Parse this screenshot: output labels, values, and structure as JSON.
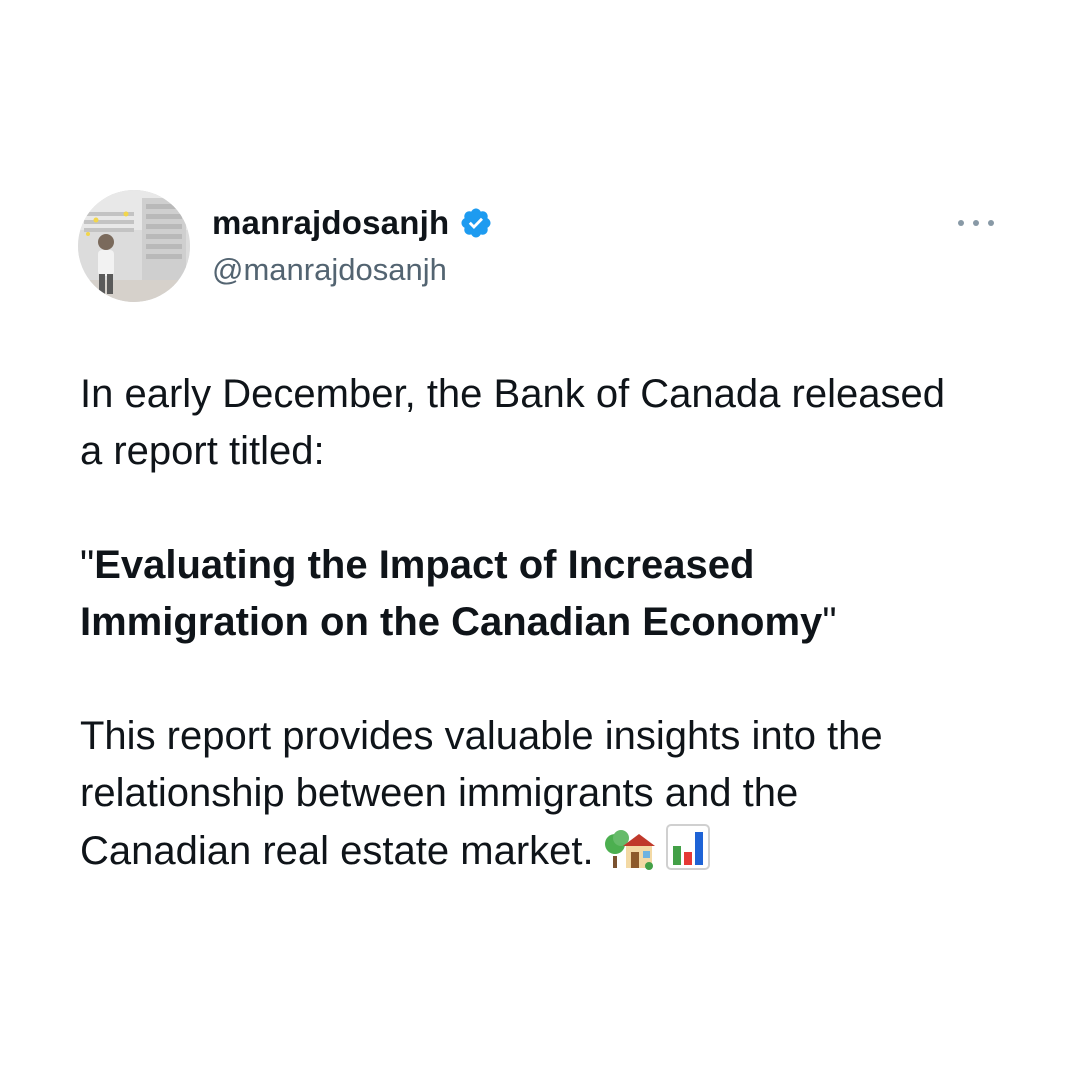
{
  "author": {
    "display_name": "manrajdosanjh",
    "handle": "@manrajdosanjh",
    "verified": true,
    "verified_color": "#1d9bf0"
  },
  "menu_icon": "more-horizontal-icon",
  "post": {
    "intro_line1": "In early December, the Bank of Canada released",
    "intro_line2": "a report titled:",
    "quote_open": "\"",
    "title_line1": "Evaluating the Impact of Increased",
    "title_line2": "Immigration on the Canadian Economy",
    "quote_close": "\"",
    "body_line1": "This report provides valuable insights into the",
    "body_line2": "relationship between immigrants and the",
    "body_line3": "Canadian real estate market.",
    "emojis": [
      "house-with-garden-icon",
      "bar-chart-icon"
    ]
  },
  "colors": {
    "text": "#0f1419",
    "secondary": "#536471",
    "background": "#ffffff"
  }
}
